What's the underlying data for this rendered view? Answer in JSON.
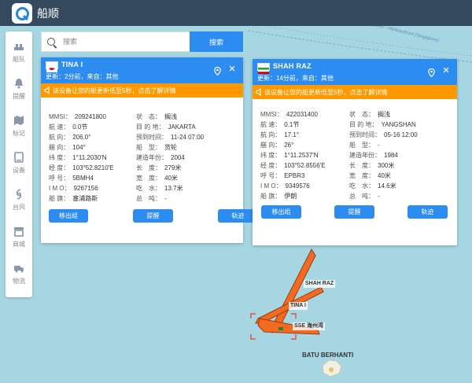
{
  "app": {
    "title": "船顺"
  },
  "sidebar": {
    "items": [
      {
        "icon": "fleet-icon",
        "label": "船队"
      },
      {
        "icon": "bell-icon",
        "label": "提醒"
      },
      {
        "icon": "map-marker-icon",
        "label": "标记"
      },
      {
        "icon": "device-icon",
        "label": "设备"
      },
      {
        "icon": "typhoon-icon",
        "label": "台风"
      },
      {
        "icon": "store-icon",
        "label": "商城"
      },
      {
        "icon": "logistics-icon",
        "label": "物流"
      }
    ]
  },
  "search": {
    "placeholder": "搜索",
    "button_label": "搜索"
  },
  "map": {
    "fairway_label": "Western Fairway (Singapore) - Harbourfront (Singapore)",
    "place_label": "BATU BERHANTI",
    "ship_tags": [
      "SHAH RAZ",
      "TINA I",
      "SSE 海州湾"
    ]
  },
  "cards": [
    {
      "name": "TINA I",
      "flag_colors": [
        "#ffffff",
        "#c8102e"
      ],
      "updated": "更新：2分前，来自：其他",
      "notice": "该设备让您的船更新低至5秒，点击了解详情",
      "rows_left": [
        {
          "label": "MMSI：",
          "value": "209241800"
        },
        {
          "label": "航 速：",
          "value": "0.0节"
        },
        {
          "label": "航 向：",
          "value": "206.0°"
        },
        {
          "label": "艏 向：",
          "value": "104°"
        },
        {
          "label": "纬 度：",
          "value": "1°11.2030'N"
        },
        {
          "label": "经 度：",
          "value": "103°52.8210'E"
        },
        {
          "label": "呼 号：",
          "value": "5BMH4"
        },
        {
          "label": "I M O：",
          "value": "9267156"
        },
        {
          "label": "船 旗：",
          "value": "塞浦路斯"
        }
      ],
      "rows_right": [
        {
          "label": "状　态：",
          "value": "搁浅"
        },
        {
          "label": "目 的 地：",
          "value": "JAKARTA"
        },
        {
          "label": "预到时间：",
          "value": "11-24 07:00"
        },
        {
          "label": "船　型：",
          "value": "货轮"
        },
        {
          "label": "建造年份：",
          "value": "2004"
        },
        {
          "label": "长　度：",
          "value": "279米"
        },
        {
          "label": "宽　度：",
          "value": "40米"
        },
        {
          "label": "吃　水：",
          "value": "13.7米"
        },
        {
          "label": "总　吨：",
          "value": "-"
        }
      ],
      "buttons": [
        "移出组",
        "提醒",
        "轨迹"
      ]
    },
    {
      "name": "SHAH RAZ",
      "flag_colors": [
        "#239f40",
        "#ffffff",
        "#da0000"
      ],
      "updated": "更新：14分前，来自：其他",
      "notice": "该设备让您的船更新低至5秒，点击了解详情",
      "rows_left": [
        {
          "label": "MMSI：",
          "value": "422031400"
        },
        {
          "label": "航 速：",
          "value": "0.1节"
        },
        {
          "label": "航 向：",
          "value": "17.1°"
        },
        {
          "label": "艏 向：",
          "value": "26°"
        },
        {
          "label": "纬 度：",
          "value": "1°11.2537'N"
        },
        {
          "label": "经 度：",
          "value": "103°52.8556'E"
        },
        {
          "label": "呼 号：",
          "value": "EPBR3"
        },
        {
          "label": "I M O：",
          "value": "9349576"
        },
        {
          "label": "船 旗：",
          "value": "伊朗"
        }
      ],
      "rows_right": [
        {
          "label": "状　态：",
          "value": "搁浅"
        },
        {
          "label": "目 的 地：",
          "value": "YANGSHAN"
        },
        {
          "label": "预到时间：",
          "value": "05-16 12:00"
        },
        {
          "label": "船　型：",
          "value": "-"
        },
        {
          "label": "建造年份：",
          "value": "1984"
        },
        {
          "label": "长　度：",
          "value": "300米"
        },
        {
          "label": "宽　度：",
          "value": "40米"
        },
        {
          "label": "吃　水：",
          "value": "14.6米"
        },
        {
          "label": "总　吨：",
          "value": "-"
        }
      ],
      "buttons": [
        "移出组",
        "提醒",
        "轨迹"
      ]
    }
  ],
  "colors": {
    "topbar": "#34495e",
    "accent": "#2d8cf0",
    "notice": "#ff9900",
    "sea": "#a7d6e3",
    "ship": "#f26b21"
  }
}
